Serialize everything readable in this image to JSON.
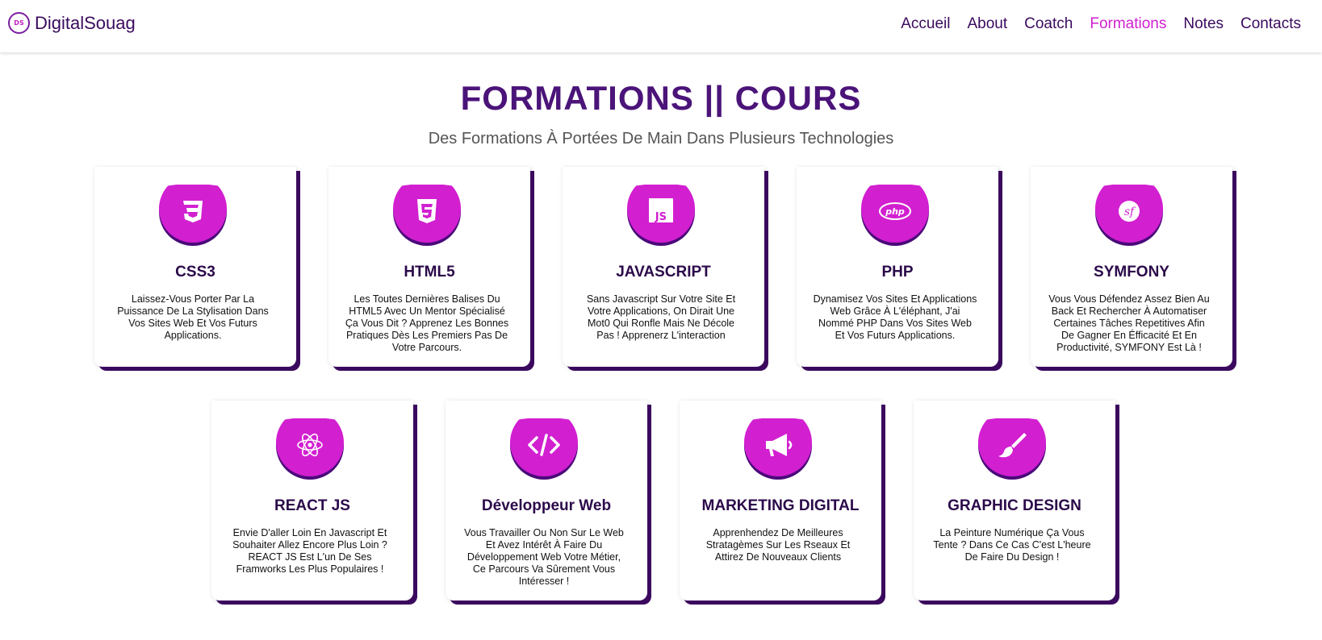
{
  "header": {
    "brand_logo_text": "DS",
    "brand_name": "DigitalSouag",
    "nav": [
      "Accueil",
      "About",
      "Coatch",
      "Formations",
      "Notes",
      "Contacts"
    ],
    "active_nav": "Formations"
  },
  "main": {
    "title": "FORMATIONS || COURS",
    "subtitle": "Des Formations À Portées De Main Dans Plusieurs Technologies",
    "cards": [
      {
        "title": "CSS3",
        "text": "Laissez-Vous Porter Par La Puissance De La Stylisation Dans Vos Sites Web Et Vos Futurs Applications.",
        "icon": "css3-icon"
      },
      {
        "title": "HTML5",
        "text": "Les Toutes Dernières Balises Du HTML5 Avec Un Mentor Spécialisé Ça Vous Dit ? Apprenez Les Bonnes Pratiques Dès Les Premiers Pas De Votre Parcours.",
        "icon": "html5-icon"
      },
      {
        "title": "JAVASCRIPT",
        "text": "Sans Javascript Sur Votre Site Et Votre Applications, On Dirait Une Mot0 Qui Ronfle Mais Ne Décole Pas ! Apprenerz L'interaction",
        "icon": "javascript-icon"
      },
      {
        "title": "PHP",
        "text": "Dynamisez Vos Sites Et Applications Web Grâce À L'éléphant, J'ai Nommé PHP Dans Vos Sites Web Et Vos Futurs Applications.",
        "icon": "php-icon"
      },
      {
        "title": "SYMFONY",
        "text": "Vous Vous Défendez Assez Bien Au Back Et Rechercher À Automatiser Certaines Tâches Repetitives Afin De Gagner En Éfficacité Et En Productivité, SYMFONY Est Là !",
        "icon": "symfony-icon"
      },
      {
        "title": "REACT JS",
        "text": "Envie D'aller Loin En Javascript Et Souhaiter Allez Encore Plus Loin ? REACT JS Est L'un De Ses Framworks Les Plus Populaires !",
        "icon": "react-icon"
      },
      {
        "title": "Développeur Web",
        "text": "Vous Travailler Ou Non Sur Le Web Et Avez Intérêt À Faire Du Développement Web Votre Métier, Ce Parcours Va Sûrement Vous Intéresser !",
        "icon": "code-icon"
      },
      {
        "title": "MARKETING DIGITAL",
        "text": "Apprenhendez De Meilleures Stratagèmes Sur Les Rseaux Et Attirez De Nouveaux Clients",
        "icon": "megaphone-icon"
      },
      {
        "title": "GRAPHIC DESIGN",
        "text": "La Peinture Numérique Ça Vous Tente ? Dans Ce Cas C'est L'heure De Faire Du Design !",
        "icon": "paintbrush-icon"
      }
    ]
  },
  "colors": {
    "accent": "#d21fd0",
    "dark": "#3b0a5e",
    "title": "#4b1479",
    "icon_shadow": "#4a0a7a"
  }
}
